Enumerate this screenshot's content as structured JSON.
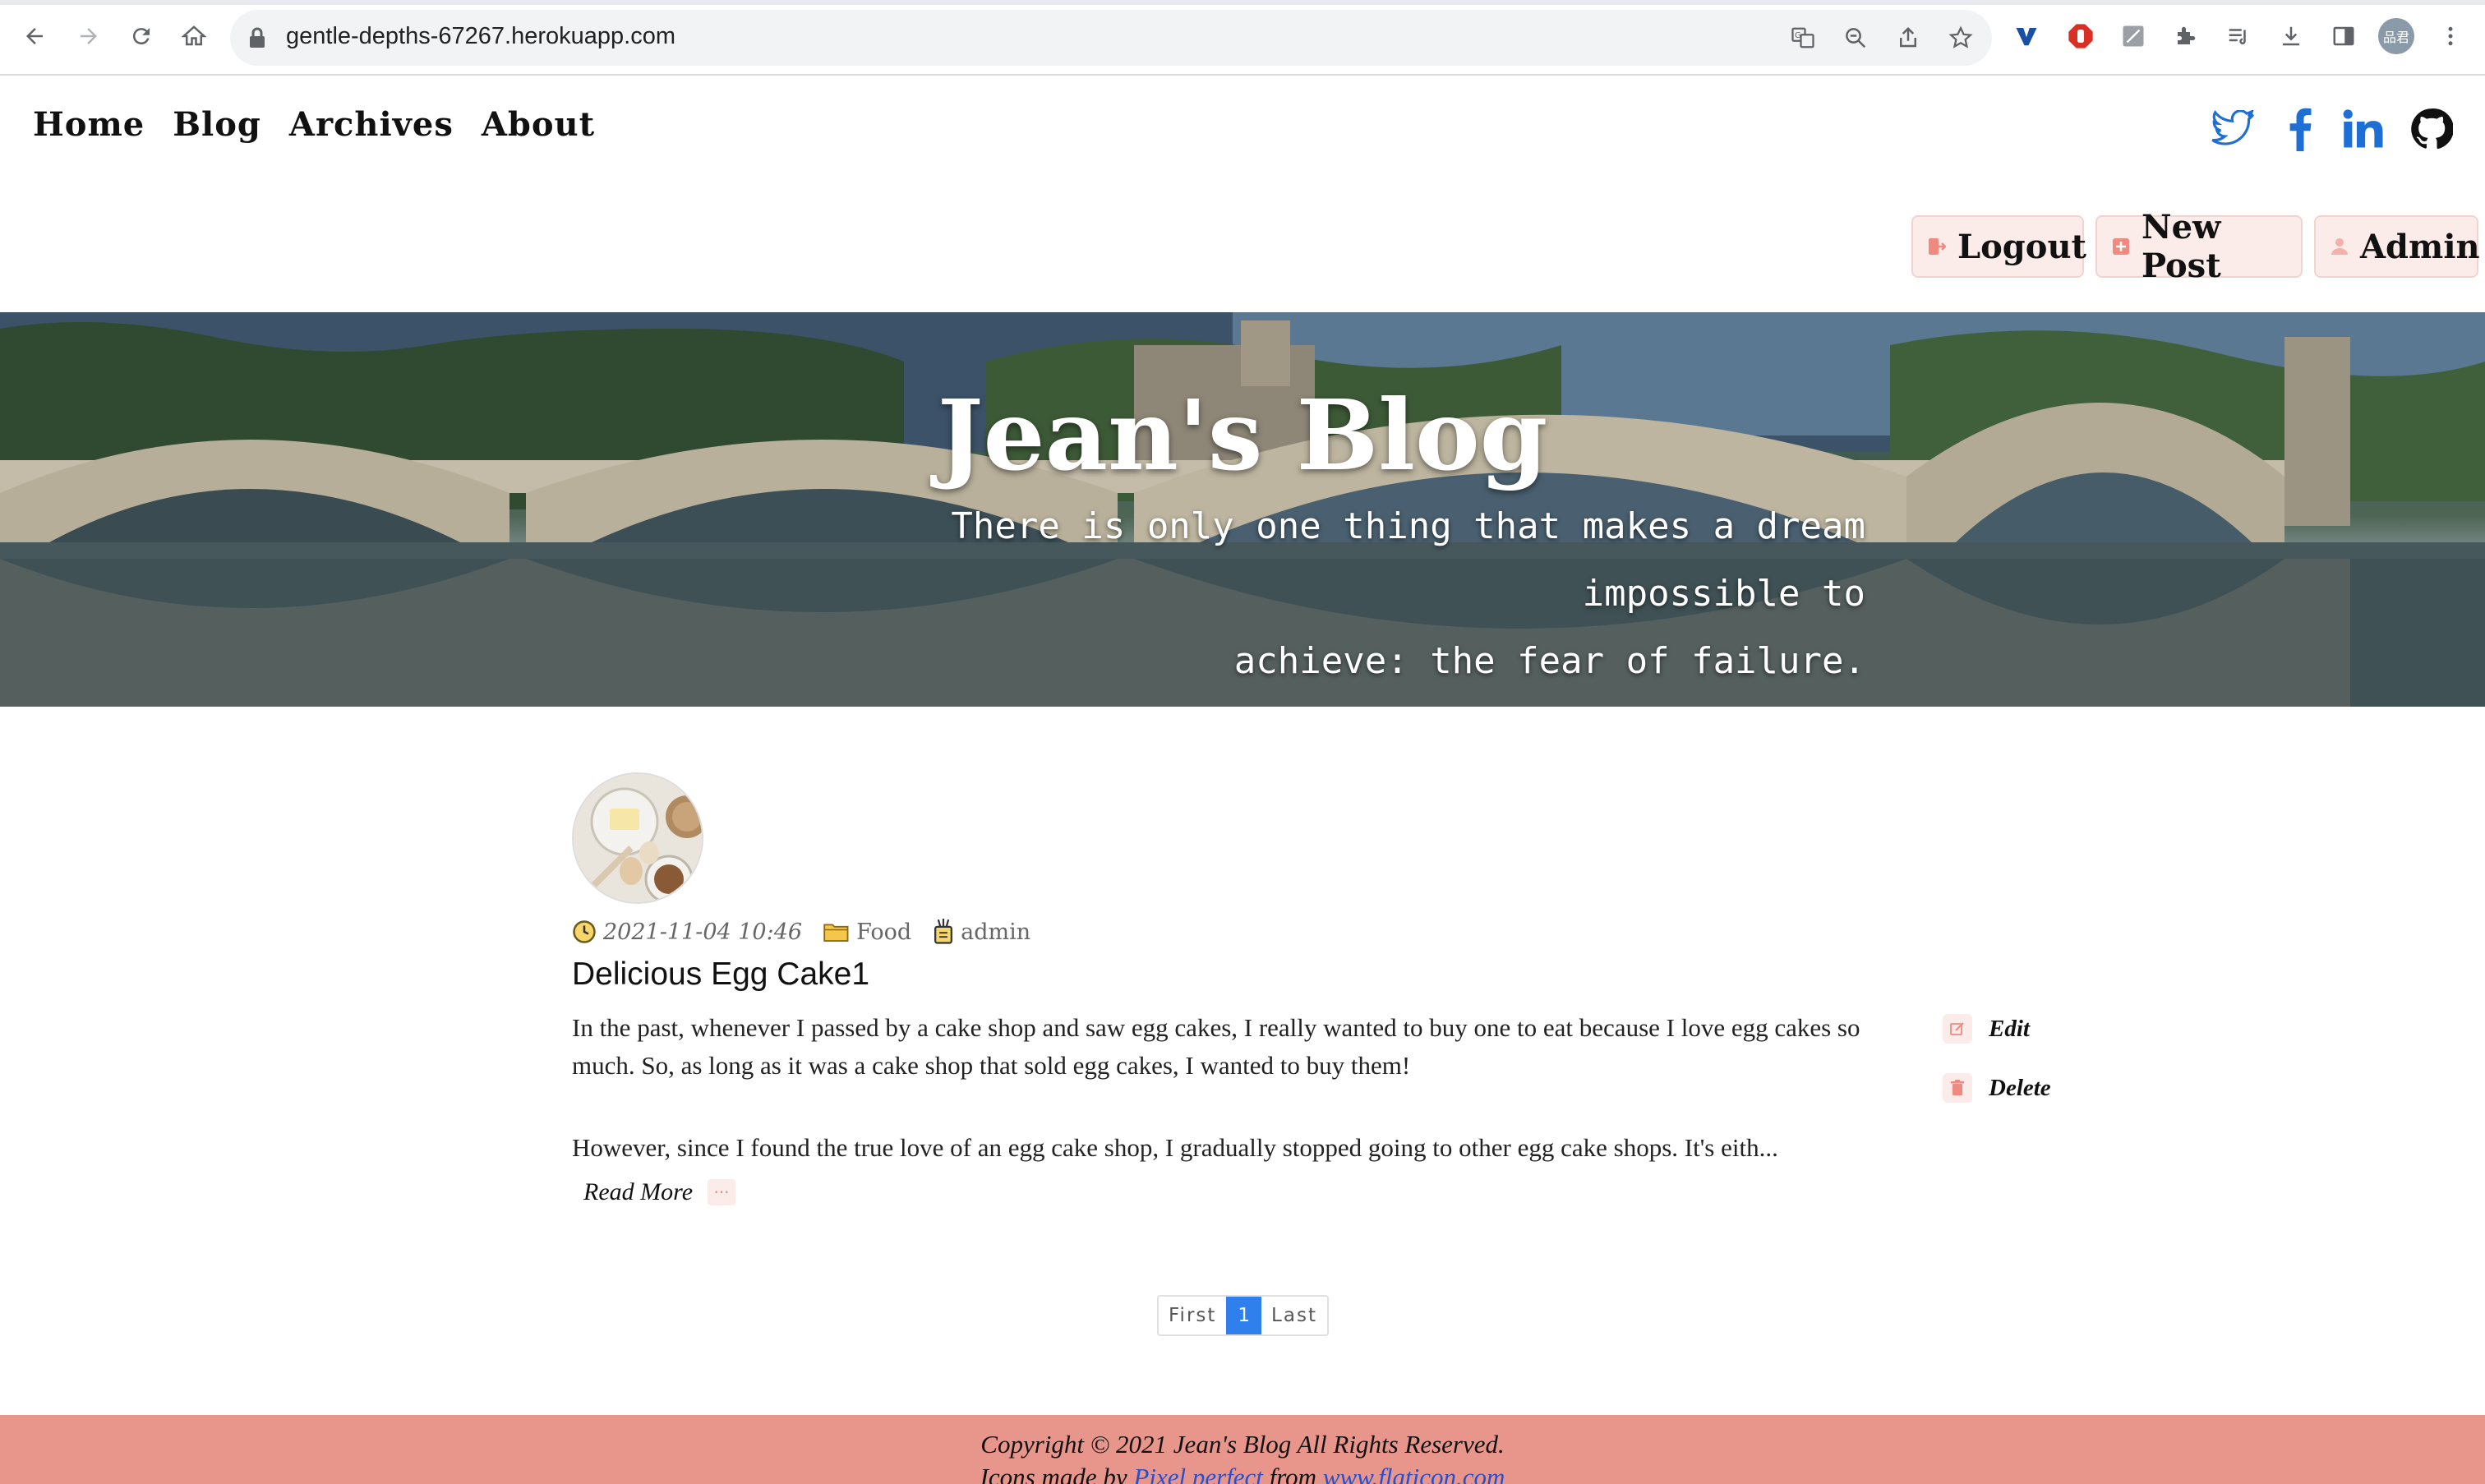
{
  "browser": {
    "url": "gentle-depths-67267.herokuapp.com",
    "profile_initials": "品君"
  },
  "nav": {
    "items": [
      "Home",
      "Blog",
      "Archives",
      "About"
    ]
  },
  "social": [
    "twitter-icon",
    "facebook-icon",
    "linkedin-icon",
    "github-icon"
  ],
  "actions": {
    "logout": "Logout",
    "new_post": "New Post",
    "admin": "Admin"
  },
  "hero": {
    "title": "Jean's Blog",
    "subtitle_line1": "There is only one thing that makes a dream impossible to",
    "subtitle_line2": "achieve: the fear of failure."
  },
  "post": {
    "date": "2021-11-04 10:46",
    "category": "Food",
    "author": "admin",
    "title": "Delicious Egg Cake1",
    "paragraph1": "In the past, whenever I passed by a cake shop and saw egg cakes, I really wanted to buy one to eat because I love egg cakes so much. So, as long as it was a cake shop that sold egg cakes, I wanted to buy them!",
    "paragraph2": "However, since I found the true love of an egg cake shop, I gradually stopped going to other egg cake shops. It's eith...",
    "read_more": "Read More",
    "more_dots": "···",
    "edit": "Edit",
    "delete": "Delete"
  },
  "pagination": {
    "first": "First",
    "current": "1",
    "last": "Last"
  },
  "footer": {
    "copyright": "Copyright © 2021 Jean's Blog All Rights Reserved.",
    "icons_prefix": "Icons made by ",
    "icons_author": "Pixel perfect",
    "icons_mid": " from ",
    "icons_site": "www.flaticon.com"
  },
  "colors": {
    "accent": "#e8968c",
    "button_bg": "#fbecea",
    "pager_active": "#2f80ed",
    "social_blue": "#1d6fd6"
  }
}
